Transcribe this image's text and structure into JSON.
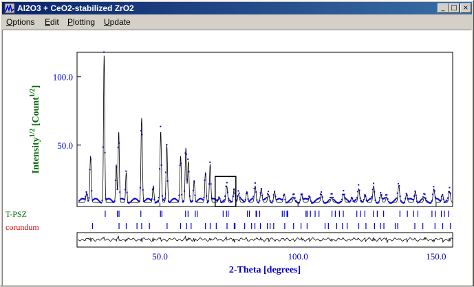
{
  "window": {
    "title": "Al2O3 + CeO2-stabilized ZrO2",
    "buttons": {
      "minimize": "_",
      "maximize": "□",
      "close": "×"
    }
  },
  "menu": [
    {
      "label": "Options",
      "mnemonic": "O",
      "rest": "ptions"
    },
    {
      "label": "Edit",
      "mnemonic": "E",
      "rest": "dit"
    },
    {
      "label": "Plotting",
      "mnemonic": "P",
      "rest": "lotting"
    },
    {
      "label": "Update",
      "mnemonic": "U",
      "rest": "pdate"
    }
  ],
  "colors": {
    "observed": "#0000cc",
    "calc": "#000000",
    "tpsz": "#006600",
    "corundum": "#cc0000",
    "ylabel": "#006600"
  },
  "chart_data": {
    "type": "scatter",
    "xlabel": "2-Theta [degrees]",
    "ylabel_base": "Intensity",
    "ylabel_sup1": "1/2",
    "ylabel_mid": " [Count",
    "ylabel_sup2": "1/2",
    "ylabel_end": "]",
    "xlim": [
      20,
      156
    ],
    "ylim": [
      5,
      118
    ],
    "xticks": [
      50,
      100,
      150
    ],
    "xtick_labels": [
      "50.0",
      "100.0",
      "150.0"
    ],
    "yticks": [
      50,
      100
    ],
    "ytick_labels": [
      "50.0",
      "100.0"
    ],
    "background": 8,
    "peaks": [
      [
        23.5,
        15,
        0.3
      ],
      [
        24.9,
        42,
        0.25
      ],
      [
        29.8,
        116,
        0.22
      ],
      [
        34.2,
        36,
        0.22
      ],
      [
        35.1,
        60,
        0.22
      ],
      [
        37.8,
        30,
        0.22
      ],
      [
        43.4,
        70,
        0.25
      ],
      [
        47.6,
        20,
        0.25
      ],
      [
        50.3,
        60,
        0.25
      ],
      [
        52.5,
        50,
        0.25
      ],
      [
        57.5,
        42,
        0.25
      ],
      [
        59.4,
        48,
        0.25
      ],
      [
        60.3,
        38,
        0.25
      ],
      [
        62.4,
        24,
        0.25
      ],
      [
        66.5,
        30,
        0.25
      ],
      [
        68.2,
        36,
        0.25
      ],
      [
        71.5,
        12,
        0.3
      ],
      [
        74.2,
        20,
        0.3
      ],
      [
        76.9,
        18,
        0.3
      ],
      [
        78.5,
        14,
        0.3
      ],
      [
        81.5,
        16,
        0.3
      ],
      [
        84.5,
        20,
        0.3
      ],
      [
        86.7,
        18,
        0.3
      ],
      [
        89.3,
        14,
        0.3
      ],
      [
        91.5,
        16,
        0.3
      ],
      [
        95.0,
        14,
        0.3
      ],
      [
        98.5,
        12,
        0.3
      ],
      [
        101.3,
        14,
        0.3
      ],
      [
        104.2,
        12,
        0.3
      ],
      [
        108.5,
        14,
        0.3
      ],
      [
        112.2,
        12,
        0.3
      ],
      [
        116.5,
        14,
        0.3
      ],
      [
        119.5,
        12,
        0.3
      ],
      [
        122.0,
        18,
        0.3
      ],
      [
        124.3,
        14,
        0.3
      ],
      [
        127.4,
        20,
        0.3
      ],
      [
        130.0,
        14,
        0.3
      ],
      [
        132.1,
        12,
        0.3
      ],
      [
        136.5,
        20,
        0.3
      ],
      [
        139.3,
        14,
        0.3
      ],
      [
        142.5,
        16,
        0.3
      ],
      [
        145.8,
        12,
        0.3
      ],
      [
        149.2,
        18,
        0.3
      ],
      [
        152.3,
        14,
        0.3
      ],
      [
        154.9,
        16,
        0.3
      ]
    ],
    "zoom_box": {
      "x": [
        70.0,
        77.5
      ],
      "y": [
        5,
        27
      ]
    },
    "phases": [
      {
        "name": "T-PSZ",
        "ticks": [
          30.2,
          34.6,
          35.2,
          43.1,
          50.2,
          50.7,
          59.3,
          60.2,
          62.8,
          63.5,
          72.9,
          74.1,
          74.7,
          81.7,
          82.4,
          84.8,
          85.0,
          86.1,
          94.3,
          95.0,
          96.0,
          96.3,
          102.9,
          103.3,
          104.5,
          106.2,
          107.6,
          112.3,
          113.5,
          115.0,
          116.4,
          121.3,
          122.6,
          124.2,
          127.3,
          128.7,
          131.0,
          136.9,
          139.6,
          141.9,
          143.4,
          148.5,
          149.7,
          151.9,
          153.0,
          154.5
        ]
      },
      {
        "name": "corundum",
        "ticks": [
          25.6,
          35.2,
          37.8,
          41.7,
          43.4,
          46.2,
          52.6,
          57.5,
          59.7,
          61.3,
          66.5,
          68.2,
          70.4,
          74.3,
          76.9,
          77.2,
          80.7,
          83.2,
          84.4,
          86.4,
          88.9,
          89.9,
          91.2,
          95.2,
          98.4,
          101.1,
          103.3,
          109.8,
          111.0,
          114.0,
          116.1,
          117.8,
          122.0,
          124.6,
          127.7,
          129.9,
          131.1,
          135.2,
          136.1,
          142.3,
          145.2,
          149.6,
          152.4,
          155.2
        ]
      }
    ]
  }
}
